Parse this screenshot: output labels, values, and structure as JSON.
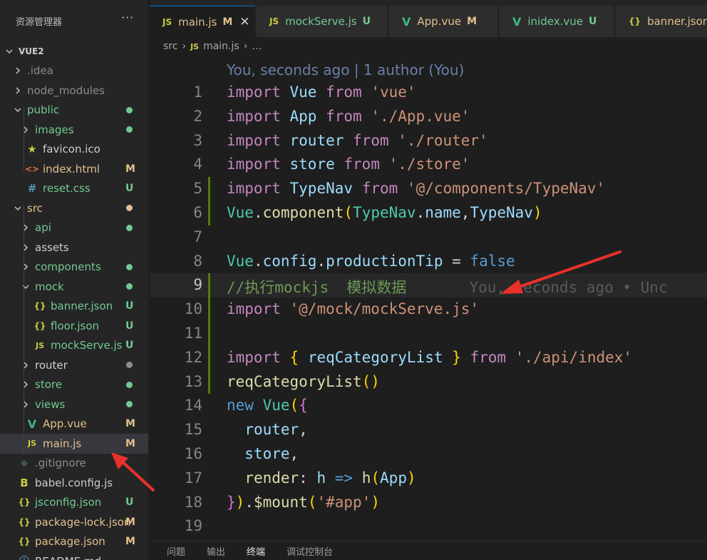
{
  "sidebar": {
    "title": "资源管理器",
    "more": "···",
    "tree": [
      {
        "label": "VUE2",
        "type": "root",
        "open": true,
        "depth": 0,
        "style": "",
        "status": ""
      },
      {
        "label": ".idea",
        "type": "folder",
        "open": false,
        "depth": 1,
        "style": "dim",
        "status": ""
      },
      {
        "label": "node_modules",
        "type": "folder",
        "open": false,
        "depth": 1,
        "style": "dim",
        "status": ""
      },
      {
        "label": "public",
        "type": "folder",
        "open": true,
        "depth": 1,
        "style": "untr",
        "status": "dot-green"
      },
      {
        "label": "images",
        "type": "folder",
        "open": false,
        "depth": 2,
        "style": "untr",
        "status": "dot-green"
      },
      {
        "label": "favicon.ico",
        "type": "file",
        "icon": "star",
        "depth": 2,
        "style": "",
        "status": ""
      },
      {
        "label": "index.html",
        "type": "file",
        "icon": "html",
        "depth": 2,
        "style": "mod",
        "status": "M"
      },
      {
        "label": "reset.css",
        "type": "file",
        "icon": "css",
        "depth": 2,
        "style": "untr",
        "status": "U"
      },
      {
        "label": "src",
        "type": "folder",
        "open": true,
        "depth": 1,
        "style": "mod",
        "status": "dot-yellow"
      },
      {
        "label": "api",
        "type": "folder",
        "open": false,
        "depth": 2,
        "style": "untr",
        "status": "dot-green"
      },
      {
        "label": "assets",
        "type": "folder",
        "open": false,
        "depth": 2,
        "style": "",
        "status": ""
      },
      {
        "label": "components",
        "type": "folder",
        "open": false,
        "depth": 2,
        "style": "untr",
        "status": "dot-green"
      },
      {
        "label": "mock",
        "type": "folder",
        "open": true,
        "depth": 2,
        "style": "untr",
        "status": "dot-green"
      },
      {
        "label": "banner.json",
        "type": "file",
        "icon": "json",
        "depth": 3,
        "style": "untr",
        "status": "U"
      },
      {
        "label": "floor.json",
        "type": "file",
        "icon": "json",
        "depth": 3,
        "style": "untr",
        "status": "U"
      },
      {
        "label": "mockServe.js",
        "type": "file",
        "icon": "js",
        "depth": 3,
        "style": "untr",
        "status": "U"
      },
      {
        "label": "router",
        "type": "folder",
        "open": false,
        "depth": 2,
        "style": "",
        "status": "dot-gray"
      },
      {
        "label": "store",
        "type": "folder",
        "open": false,
        "depth": 2,
        "style": "untr",
        "status": "dot-green"
      },
      {
        "label": "views",
        "type": "folder",
        "open": false,
        "depth": 2,
        "style": "untr",
        "status": "dot-green"
      },
      {
        "label": "App.vue",
        "type": "file",
        "icon": "vue",
        "depth": 2,
        "style": "mod",
        "status": "M"
      },
      {
        "label": "main.js",
        "type": "file",
        "icon": "js",
        "depth": 2,
        "style": "mod",
        "status": "M",
        "active": true
      },
      {
        "label": ".gitignore",
        "type": "file",
        "icon": "git",
        "depth": 1,
        "style": "ign",
        "status": ""
      },
      {
        "label": "babel.config.js",
        "type": "file",
        "icon": "babel",
        "depth": 1,
        "style": "",
        "status": ""
      },
      {
        "label": "jsconfig.json",
        "type": "file",
        "icon": "json",
        "depth": 1,
        "style": "untr",
        "status": "U"
      },
      {
        "label": "package-lock.json",
        "type": "file",
        "icon": "json",
        "depth": 1,
        "style": "mod",
        "status": "M"
      },
      {
        "label": "package.json",
        "type": "file",
        "icon": "json",
        "depth": 1,
        "style": "mod",
        "status": "M"
      },
      {
        "label": "README.md",
        "type": "file",
        "icon": "info",
        "depth": 1,
        "style": "",
        "status": ""
      }
    ]
  },
  "tabs": [
    {
      "label": "main.js",
      "icon": "JS",
      "icon_color": "#cbcb41",
      "status": "M",
      "active": true,
      "close": "✕"
    },
    {
      "label": "mockServe.js",
      "icon": "JS",
      "icon_color": "#cbcb41",
      "status": "U",
      "active": false
    },
    {
      "label": "App.vue",
      "icon": "V",
      "icon_color": "#41b883",
      "status": "M",
      "active": false
    },
    {
      "label": "inidex.vue",
      "icon": "V",
      "icon_color": "#41b883",
      "status": "U",
      "active": false
    },
    {
      "label": "banner.json",
      "icon": "{}",
      "icon_color": "#cbcb41",
      "status": "",
      "active": false
    }
  ],
  "breadcrumb": {
    "folder": "src",
    "icon": "JS",
    "file": "main.js",
    "tail": "…"
  },
  "editor": {
    "blame_header": "You, seconds ago | 1 author (You)",
    "current_line": 9,
    "inline_blame": "You, seconds ago • Unc",
    "lines": [
      {
        "n": "1",
        "gutter": "",
        "tokens": [
          [
            "kw",
            "import"
          ],
          [
            "def",
            " "
          ],
          [
            "id",
            "Vue"
          ],
          [
            "def",
            " "
          ],
          [
            "kw",
            "from"
          ],
          [
            "def",
            " "
          ],
          [
            "str",
            "'vue'"
          ]
        ]
      },
      {
        "n": "2",
        "gutter": "",
        "tokens": [
          [
            "kw",
            "import"
          ],
          [
            "def",
            " "
          ],
          [
            "id",
            "App"
          ],
          [
            "def",
            " "
          ],
          [
            "kw",
            "from"
          ],
          [
            "def",
            " "
          ],
          [
            "str",
            "'./App.vue'"
          ]
        ]
      },
      {
        "n": "3",
        "gutter": "",
        "tokens": [
          [
            "kw",
            "import"
          ],
          [
            "def",
            " "
          ],
          [
            "id",
            "router"
          ],
          [
            "def",
            " "
          ],
          [
            "kw",
            "from"
          ],
          [
            "def",
            " "
          ],
          [
            "str",
            "'./router'"
          ]
        ]
      },
      {
        "n": "4",
        "gutter": "",
        "tokens": [
          [
            "kw",
            "import"
          ],
          [
            "def",
            " "
          ],
          [
            "id",
            "store"
          ],
          [
            "def",
            " "
          ],
          [
            "kw",
            "from"
          ],
          [
            "def",
            " "
          ],
          [
            "str",
            "'./store'"
          ]
        ]
      },
      {
        "n": "5",
        "gutter": "add",
        "tokens": [
          [
            "kw",
            "import"
          ],
          [
            "def",
            " "
          ],
          [
            "id",
            "TypeNav"
          ],
          [
            "def",
            " "
          ],
          [
            "kw",
            "from"
          ],
          [
            "def",
            " "
          ],
          [
            "str",
            "'@/components/TypeNav'"
          ]
        ]
      },
      {
        "n": "6",
        "gutter": "add",
        "tokens": [
          [
            "cls",
            "Vue"
          ],
          [
            "def",
            "."
          ],
          [
            "fn",
            "component"
          ],
          [
            "br1",
            "("
          ],
          [
            "cls",
            "TypeNav"
          ],
          [
            "def",
            "."
          ],
          [
            "id",
            "name"
          ],
          [
            "def",
            ","
          ],
          [
            "id",
            "TypeNav"
          ],
          [
            "br1",
            ")"
          ]
        ]
      },
      {
        "n": "7",
        "gutter": "",
        "tokens": []
      },
      {
        "n": "8",
        "gutter": "",
        "tokens": [
          [
            "cls",
            "Vue"
          ],
          [
            "def",
            "."
          ],
          [
            "id",
            "config"
          ],
          [
            "def",
            "."
          ],
          [
            "id",
            "productionTip"
          ],
          [
            "def",
            " = "
          ],
          [
            "kw2",
            "false"
          ]
        ]
      },
      {
        "n": "9",
        "gutter": "add",
        "tokens": [
          [
            "cm",
            "//执行mockjs  模拟数据"
          ]
        ]
      },
      {
        "n": "10",
        "gutter": "add",
        "tokens": [
          [
            "kw",
            "import"
          ],
          [
            "def",
            " "
          ],
          [
            "str",
            "'@/mock/mockServe.js'"
          ]
        ]
      },
      {
        "n": "11",
        "gutter": "add",
        "tokens": []
      },
      {
        "n": "12",
        "gutter": "add",
        "tokens": [
          [
            "kw",
            "import"
          ],
          [
            "def",
            " "
          ],
          [
            "br1",
            "{"
          ],
          [
            "def",
            " "
          ],
          [
            "id",
            "reqCategoryList"
          ],
          [
            "def",
            " "
          ],
          [
            "br1",
            "}"
          ],
          [
            "def",
            " "
          ],
          [
            "kw",
            "from"
          ],
          [
            "def",
            " "
          ],
          [
            "str",
            "'./api/index'"
          ]
        ]
      },
      {
        "n": "13",
        "gutter": "add",
        "tokens": [
          [
            "fn",
            "reqCategoryList"
          ],
          [
            "br1",
            "()"
          ]
        ]
      },
      {
        "n": "14",
        "gutter": "",
        "tokens": [
          [
            "kw2",
            "new"
          ],
          [
            "def",
            " "
          ],
          [
            "cls",
            "Vue"
          ],
          [
            "br1",
            "("
          ],
          [
            "br2",
            "{"
          ]
        ]
      },
      {
        "n": "15",
        "gutter": "",
        "tokens": [
          [
            "def",
            "  "
          ],
          [
            "id",
            "router"
          ],
          [
            "def",
            ","
          ]
        ]
      },
      {
        "n": "16",
        "gutter": "",
        "tokens": [
          [
            "def",
            "  "
          ],
          [
            "id",
            "store"
          ],
          [
            "def",
            ","
          ]
        ]
      },
      {
        "n": "17",
        "gutter": "",
        "tokens": [
          [
            "def",
            "  "
          ],
          [
            "fn",
            "render"
          ],
          [
            "def",
            ": "
          ],
          [
            "id",
            "h"
          ],
          [
            "def",
            " "
          ],
          [
            "kw2",
            "=>"
          ],
          [
            "def",
            " "
          ],
          [
            "fn",
            "h"
          ],
          [
            "br1",
            "("
          ],
          [
            "id",
            "App"
          ],
          [
            "br1",
            ")"
          ]
        ]
      },
      {
        "n": "18",
        "gutter": "",
        "tokens": [
          [
            "br2",
            "}"
          ],
          [
            "br1",
            ")"
          ],
          [
            "def",
            "."
          ],
          [
            "fn",
            "$mount"
          ],
          [
            "br1",
            "("
          ],
          [
            "str",
            "'#app'"
          ],
          [
            "br1",
            ")"
          ]
        ]
      },
      {
        "n": "19",
        "gutter": "",
        "tokens": []
      }
    ]
  },
  "panel": {
    "tabs": [
      "问题",
      "输出",
      "终端",
      "调试控制台"
    ],
    "active": 2
  },
  "colors": {
    "accent": "#0078d4",
    "modified": "#e2c08d",
    "untracked": "#73c991",
    "annotation_arrow": "#e8312a"
  }
}
